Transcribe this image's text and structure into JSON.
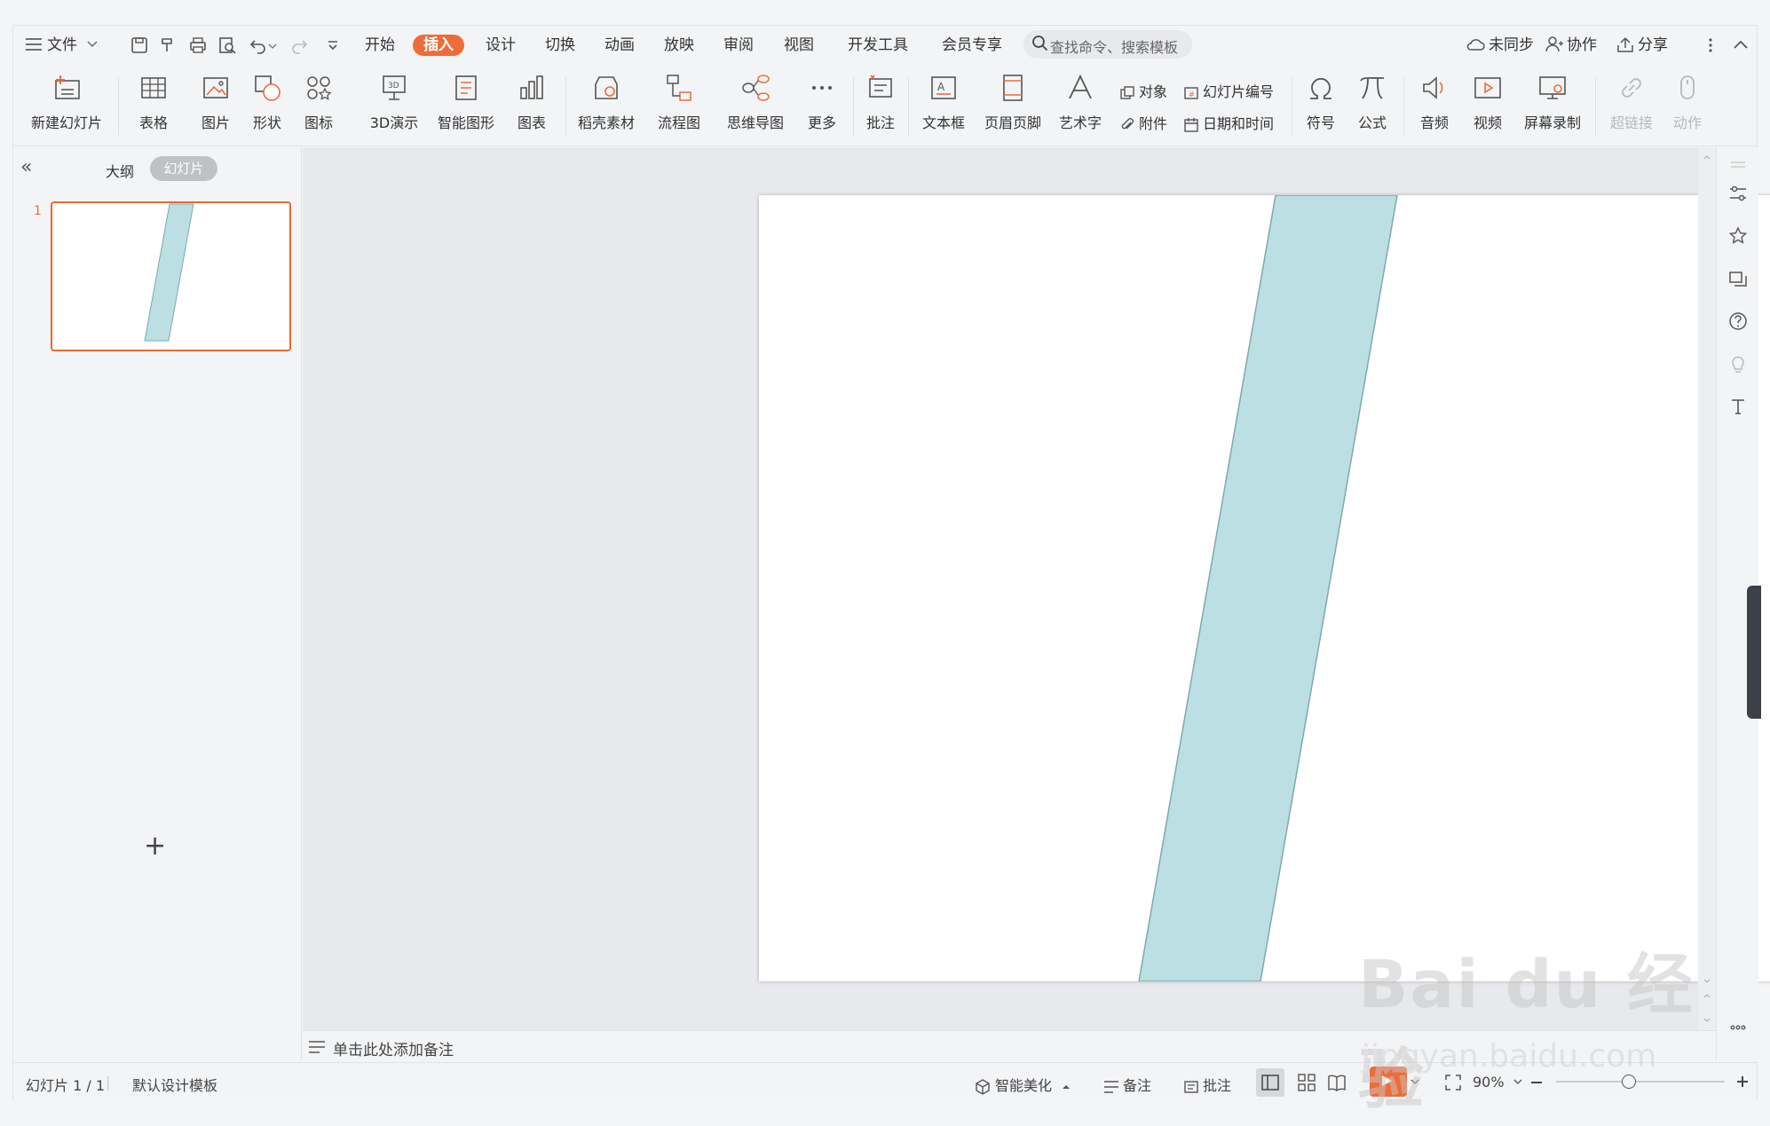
{
  "menu": {
    "file": "文件",
    "tabs": [
      "开始",
      "插入",
      "设计",
      "切换",
      "动画",
      "放映",
      "审阅",
      "视图",
      "开发工具",
      "会员专享"
    ],
    "active_tab": "插入",
    "search_placeholder": "查找命令、搜索模板",
    "sync": "未同步",
    "collab": "协作",
    "share": "分享"
  },
  "ribbon": {
    "new_slide": "新建幻灯片",
    "table": "表格",
    "picture": "图片",
    "shape": "形状",
    "icon": "图标",
    "demo3d": "3D演示",
    "smartart": "智能图形",
    "chart": "图表",
    "docer": "稻壳素材",
    "flowchart": "流程图",
    "mindmap": "思维导图",
    "more": "更多",
    "comment": "批注",
    "textbox": "文本框",
    "header_footer": "页眉页脚",
    "wordart": "艺术字",
    "object": "对象",
    "slide_number": "幻灯片编号",
    "attachment": "附件",
    "datetime": "日期和时间",
    "symbol": "符号",
    "formula": "公式",
    "audio": "音频",
    "video": "视频",
    "screen_record": "屏幕录制",
    "hyperlink": "超链接",
    "action": "动作"
  },
  "left_panel": {
    "outline_tab": "大纲",
    "slides_tab": "幻灯片",
    "slide_number": "1"
  },
  "slide": {
    "shape_fill": "#bbdfe2",
    "shape_stroke": "#7fa9ad"
  },
  "notes": {
    "placeholder": "单击此处添加备注"
  },
  "status": {
    "slide_info": "幻灯片 1 / 1",
    "template": "默认设计模板",
    "beautify": "智能美化",
    "notes": "备注",
    "comments": "批注",
    "zoom": "90%"
  },
  "colors": {
    "accent": "#ed6c3a",
    "thumb_border": "#e8692e"
  },
  "watermark": {
    "brand": "Bai du 经验",
    "url": "jingyan.baidu.com"
  }
}
